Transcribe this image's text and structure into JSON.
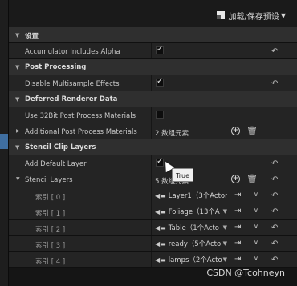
{
  "toolbar": {
    "preset_label": "加载/保存预设",
    "preset_icon": "preset-icon"
  },
  "sections": {
    "settings": {
      "title": "设置",
      "accumulator": {
        "label": "Accumulator Includes Alpha",
        "checked": true
      }
    },
    "post": {
      "title": "Post Processing",
      "multisample": {
        "label": "Disable Multisample Effects",
        "checked": true
      }
    },
    "deferred": {
      "title": "Deferred Renderer Data",
      "use32": {
        "label": "Use 32Bit Post Process Materials",
        "checked": false
      },
      "additional": {
        "label": "Additional Post Process Materials",
        "value": "2 数组元素"
      }
    },
    "stencil": {
      "title": "Stencil Clip Layers",
      "default_layer": {
        "label": "Add Default Layer",
        "checked": true
      },
      "layers": {
        "label": "Stencil Layers",
        "value": "5 数组元素"
      },
      "items": [
        {
          "index": "索引 [ 0 ]",
          "actor": "Layer1（3个Actor"
        },
        {
          "index": "索引 [ 1 ]",
          "actor": "Foliage（13个A"
        },
        {
          "index": "索引 [ 2 ]",
          "actor": "Table（1个Acto"
        },
        {
          "index": "索引 [ 3 ]",
          "actor": "ready（5个Acto"
        },
        {
          "index": "索引 [ 4 ]",
          "actor": "lamps（2个Acto"
        }
      ]
    }
  },
  "tooltip": "True",
  "watermark": "CSDN @Tcohneyn",
  "colors": {
    "selection": "#3f6ea0",
    "background": "#151515"
  }
}
